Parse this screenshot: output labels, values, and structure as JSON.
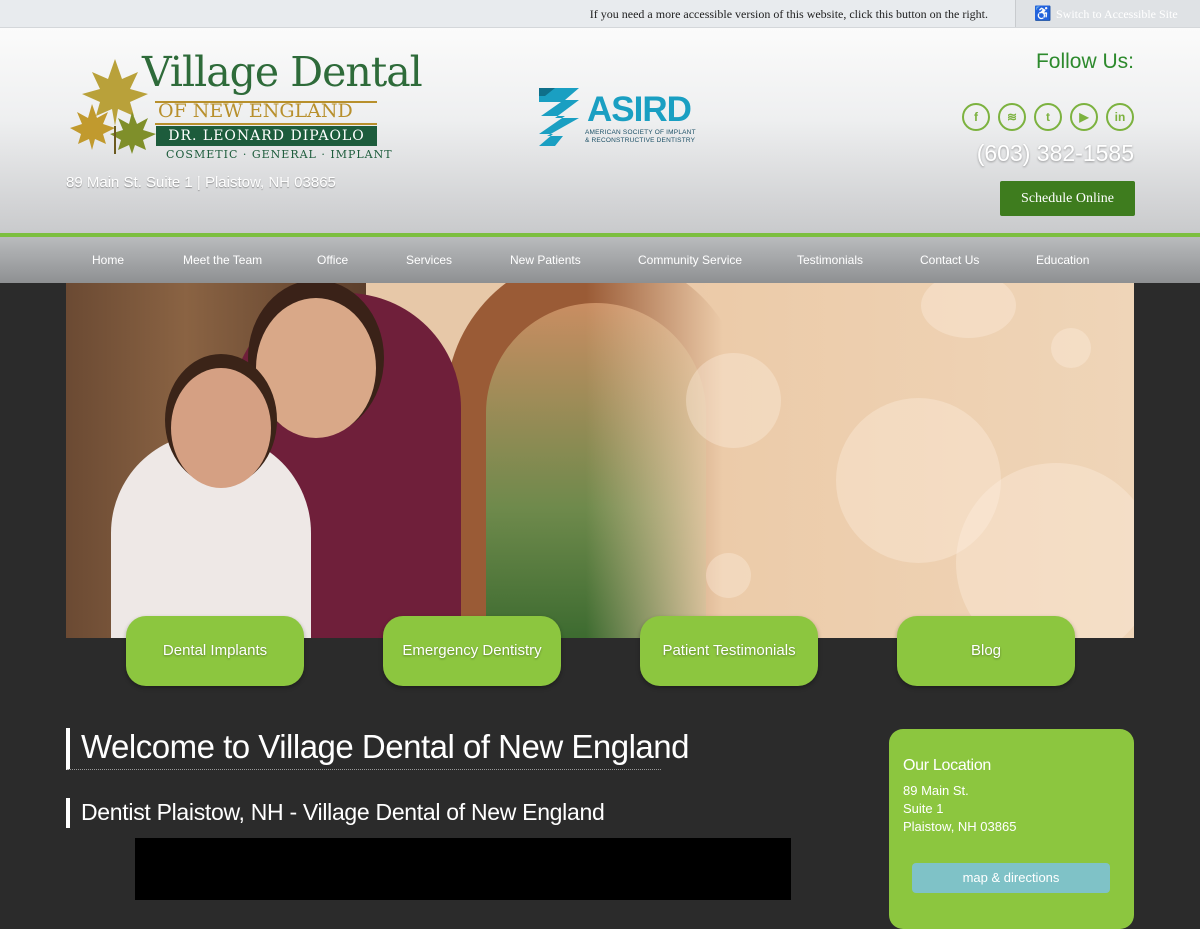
{
  "accessibility": {
    "message": "If you need a more accessible version of this website, click this button on the right.",
    "button_label": "Switch to Accessible Site",
    "icon": "wheelchair-icon"
  },
  "header": {
    "logo": {
      "title": "Village Dental",
      "subtitle": "OF NEW ENGLAND",
      "doctor": "DR. LEONARD DIPAOLO",
      "tagline": "COSMETIC · GENERAL · IMPLANT"
    },
    "address": "89 Main St. Suite 1 | Plaistow, NH 03865",
    "asird": {
      "title": "ASIRD",
      "sub_line1": "AMERICAN SOCIETY OF IMPLANT",
      "sub_line2": "& RECONSTRUCTIVE DENTISTRY"
    },
    "follow_label": "Follow Us:",
    "social": [
      {
        "name": "facebook-icon",
        "glyph": "f"
      },
      {
        "name": "rss-icon",
        "glyph": "≋"
      },
      {
        "name": "twitter-icon",
        "glyph": "t"
      },
      {
        "name": "youtube-icon",
        "glyph": "▶"
      },
      {
        "name": "linkedin-icon",
        "glyph": "in"
      }
    ],
    "phone": "(603) 382-1585",
    "schedule_label": "Schedule Online"
  },
  "nav": {
    "items": [
      "Home",
      "Meet the Team",
      "Office",
      "Services",
      "New Patients",
      "Community Service",
      "Testimonials",
      "Contact Us",
      "Education"
    ]
  },
  "tiles": [
    "Dental Implants",
    "Emergency Dentistry",
    "Patient Testimonials",
    "Blog"
  ],
  "main": {
    "title": "Welcome to Village Dental of New England",
    "subtitle": "Dentist Plaistow, NH - Village Dental of New England"
  },
  "location": {
    "title": "Our Location",
    "line1": "89 Main St.",
    "line2": "Suite 1",
    "line3": "Plaistow, NH 03865",
    "button_label": "map & directions"
  },
  "colors": {
    "accent_green": "#8cc63f",
    "dark_green": "#3e7c1e",
    "background": "#2b2b2b",
    "asird_blue": "#1a9fc2"
  }
}
